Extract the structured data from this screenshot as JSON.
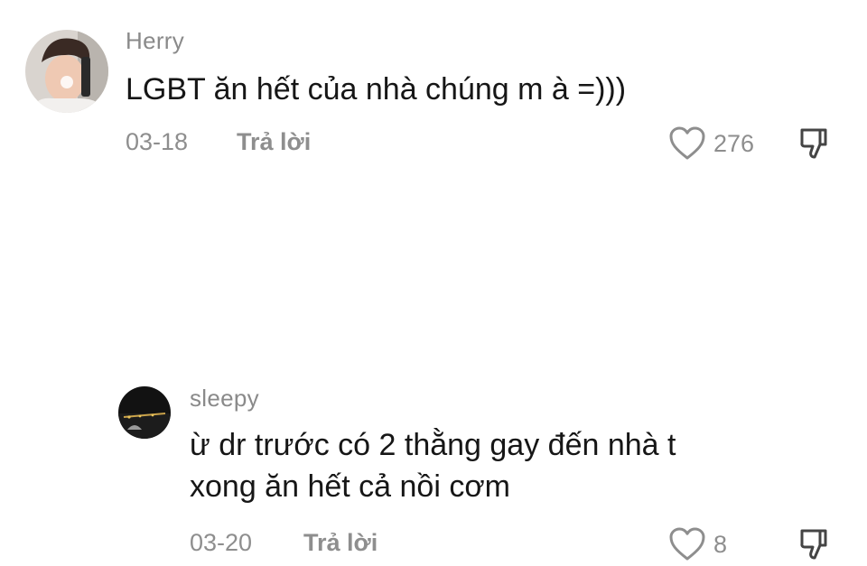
{
  "comments": [
    {
      "username": "Herry",
      "text_lines": [
        "LGBT ăn hết của nhà chúng m à =)))"
      ],
      "date": "03-18",
      "reply_label": "Trả lời",
      "likes": "276",
      "like_icon": "heart-icon",
      "dislike_icon": "thumbs-down-icon"
    },
    {
      "username": "sleepy",
      "text_lines": [
        "ừ dr trước có 2 thằng gay đến nhà t",
        "xong ăn hết cả nồi cơm"
      ],
      "date": "03-20",
      "reply_label": "Trả lời",
      "likes": "8",
      "like_icon": "heart-icon",
      "dislike_icon": "thumbs-down-icon"
    }
  ]
}
